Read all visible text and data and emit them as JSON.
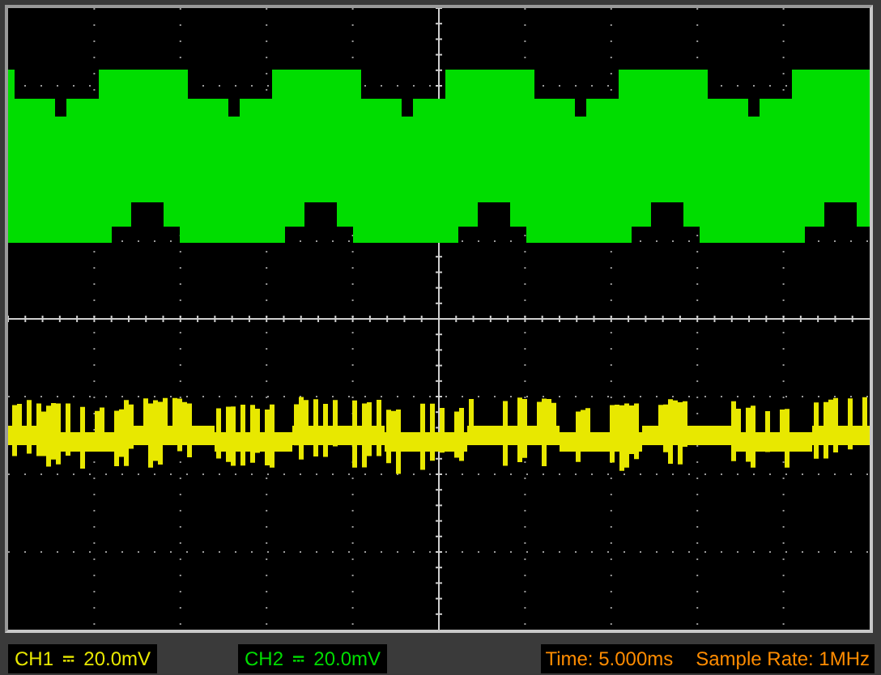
{
  "channels": [
    {
      "label": "CH1",
      "value": "20.0mV",
      "color": "#e8e800"
    },
    {
      "label": "CH2",
      "value": "20.0mV",
      "color": "#00dd00"
    }
  ],
  "timebase": "Time: 5.000ms",
  "sample_rate": "Sample Rate: 1MHz"
}
